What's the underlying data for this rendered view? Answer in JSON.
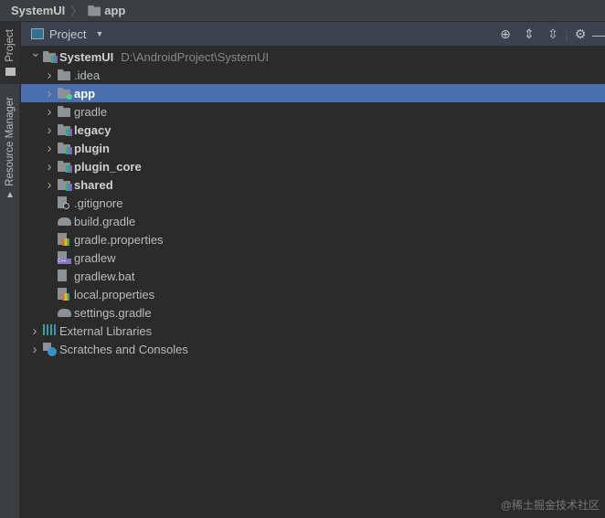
{
  "breadcrumb": [
    "SystemUI",
    "app"
  ],
  "sidebar": {
    "project_tab": "Project",
    "resource_tab": "Resource Manager"
  },
  "panel": {
    "title": "Project",
    "tools": [
      "locate-icon",
      "expand-all-icon",
      "collapse-all-icon",
      "gear-icon",
      "minimize-icon"
    ]
  },
  "tree": [
    {
      "label": "SystemUI",
      "path": "D:\\AndroidProject\\SystemUI",
      "level": 0,
      "chevron": "expanded",
      "icon": "module",
      "bold": true
    },
    {
      "label": ".idea",
      "level": 1,
      "chevron": "collapsed",
      "icon": "folder"
    },
    {
      "label": "app",
      "level": 1,
      "chevron": "collapsed",
      "icon": "app-folder",
      "bold": true,
      "selected": true
    },
    {
      "label": "gradle",
      "level": 1,
      "chevron": "collapsed",
      "icon": "folder"
    },
    {
      "label": "legacy",
      "level": 1,
      "chevron": "collapsed",
      "icon": "module",
      "bold": true
    },
    {
      "label": "plugin",
      "level": 1,
      "chevron": "collapsed",
      "icon": "module",
      "bold": true
    },
    {
      "label": "plugin_core",
      "level": 1,
      "chevron": "collapsed",
      "icon": "module",
      "bold": true
    },
    {
      "label": "shared",
      "level": 1,
      "chevron": "collapsed",
      "icon": "module",
      "bold": true
    },
    {
      "label": ".gitignore",
      "level": 1,
      "icon": "ignore-file"
    },
    {
      "label": "build.gradle",
      "level": 1,
      "icon": "gradle"
    },
    {
      "label": "gradle.properties",
      "level": 1,
      "icon": "properties"
    },
    {
      "label": "gradlew",
      "level": 1,
      "icon": "cpp-file"
    },
    {
      "label": "gradlew.bat",
      "level": 1,
      "icon": "text-file"
    },
    {
      "label": "local.properties",
      "level": 1,
      "icon": "properties"
    },
    {
      "label": "settings.gradle",
      "level": 1,
      "icon": "gradle"
    },
    {
      "label": "External Libraries",
      "level": 0,
      "chevron": "collapsed",
      "icon": "libraries"
    },
    {
      "label": "Scratches and Consoles",
      "level": 0,
      "chevron": "collapsed",
      "icon": "scratches"
    }
  ],
  "watermark": "@稀土掘金技术社区",
  "colors": {
    "selection": "#4b6eaf",
    "header": "#3c4250",
    "background": "#2b2b2b"
  }
}
